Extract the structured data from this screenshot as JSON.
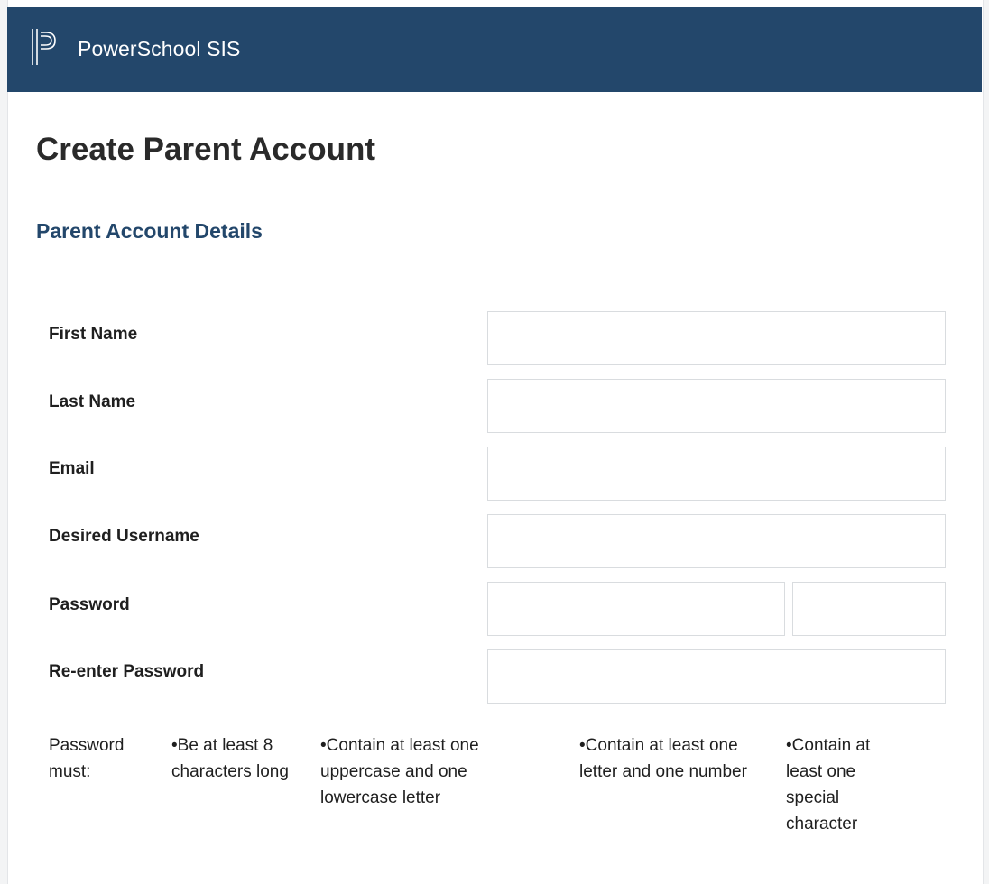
{
  "header": {
    "brand": "PowerSchool SIS",
    "logo_icon": "powerschool-logo-icon",
    "bg_color": "#23476b"
  },
  "page": {
    "title": "Create Parent Account",
    "section_title": "Parent Account Details",
    "section_color": "#23476b"
  },
  "form": {
    "first_name": {
      "label": "First Name",
      "value": "",
      "placeholder": ""
    },
    "last_name": {
      "label": "Last Name",
      "value": "",
      "placeholder": ""
    },
    "email": {
      "label": "Email",
      "value": "",
      "placeholder": ""
    },
    "username": {
      "label": "Desired Username",
      "value": "",
      "placeholder": ""
    },
    "password": {
      "label": "Password",
      "value": "",
      "placeholder": "",
      "strength": ""
    },
    "reenter_password": {
      "label": "Re-enter Password",
      "value": "",
      "placeholder": ""
    }
  },
  "password_rules": {
    "intro": "Password must:",
    "rules": [
      "•Be at least 8 characters long",
      "•Contain at least one uppercase and one lowercase letter",
      "•Contain at least one letter and one number",
      "•Contain at least one special character"
    ]
  }
}
